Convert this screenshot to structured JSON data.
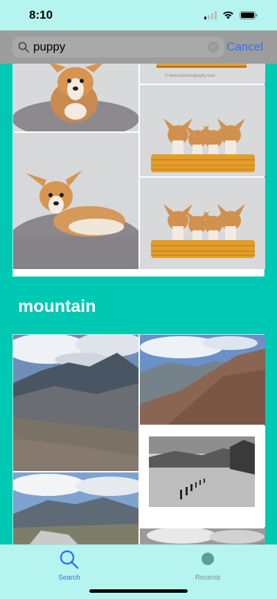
{
  "status": {
    "time": "8:10"
  },
  "search": {
    "query": "puppy",
    "cancel_label": "Cancel"
  },
  "sections": {
    "mountain": {
      "title": "mountain"
    }
  },
  "tabs": [
    {
      "label": "Search",
      "icon": "search-icon",
      "active": true
    },
    {
      "label": "Recents",
      "icon": "recents-icon",
      "active": false
    }
  ],
  "colors": {
    "background": "#00c9b3",
    "bars": "#b6f4ef",
    "accent": "#2f6ff3"
  },
  "watermark": "© www.dvphotography.com"
}
